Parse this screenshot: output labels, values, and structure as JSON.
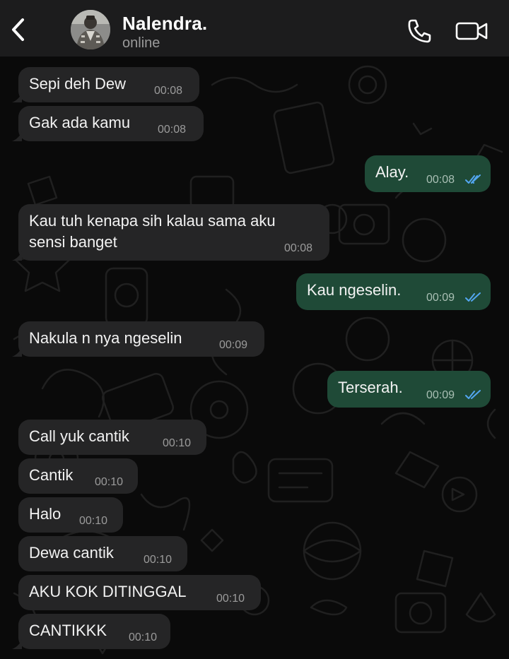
{
  "header": {
    "back_icon": "chevron-left-icon",
    "contact_name": "Nalendra.",
    "status": "online",
    "call_icon": "phone-icon",
    "video_icon": "video-camera-icon"
  },
  "colors": {
    "header_bg": "#1c1c1d",
    "incoming_bubble": "#252526",
    "outgoing_bubble": "#1f4a37",
    "read_ticks": "#53a6f0"
  },
  "messages": [
    {
      "dir": "in",
      "text": "Sepi deh Dew",
      "time": "00:08"
    },
    {
      "dir": "in",
      "text": "Gak ada kamu",
      "time": "00:08"
    },
    {
      "dir": "out",
      "text": "Alay.",
      "time": "00:08",
      "status": "read"
    },
    {
      "dir": "in",
      "text": "Kau tuh kenapa sih kalau sama aku\nsensi banget",
      "time": "00:08"
    },
    {
      "dir": "out",
      "text": "Kau ngeselin.",
      "time": "00:09",
      "status": "read"
    },
    {
      "dir": "in",
      "text": "Nakula n nya ngeselin",
      "time": "00:09"
    },
    {
      "dir": "out",
      "text": "Terserah.",
      "time": "00:09",
      "status": "read"
    },
    {
      "dir": "in",
      "text": "Call yuk cantik",
      "time": "00:10"
    },
    {
      "dir": "in",
      "text": "Cantik",
      "time": "00:10"
    },
    {
      "dir": "in",
      "text": "Halo",
      "time": "00:10"
    },
    {
      "dir": "in",
      "text": "Dewa cantik",
      "time": "00:10"
    },
    {
      "dir": "in",
      "text": "AKU KOK DITINGGAL",
      "time": "00:10"
    },
    {
      "dir": "in",
      "text": "CANTIKKK",
      "time": "00:10"
    }
  ]
}
